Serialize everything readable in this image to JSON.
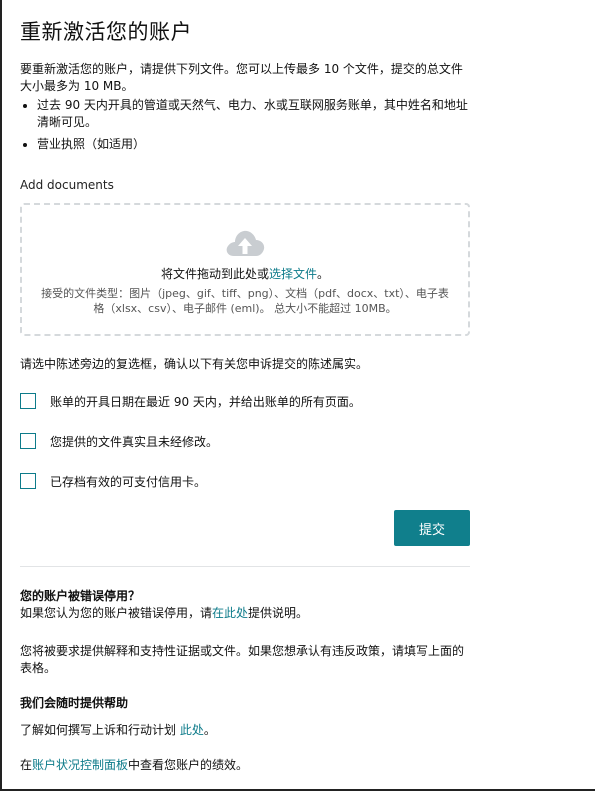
{
  "page": {
    "title": "重新激活您的账户",
    "intro": "要重新激活您的账户，请提供下列文件。您可以上传最多 10 个文件，提交的总文件大小最多为 10 MB。",
    "required_docs": [
      "过去 90 天内开具的管道或天然气、电力、水或互联网服务账单，其中姓名和地址清晰可见。",
      "营业执照（如适用）"
    ]
  },
  "upload": {
    "label": "Add documents",
    "drop_prefix": "将文件拖动到此处或",
    "choose_link": "选择文件",
    "drop_suffix": "。",
    "file_types": "接受的文件类型：图片（jpeg、gif、tiff、png）、文档（pdf、docx、txt）、电子表格（xlsx、csv）、电子邮件 (eml)。 总大小不能超过 10MB。",
    "icon": "cloud-upload-icon",
    "icon_color": "#c9cdd1"
  },
  "confirm": {
    "instruction": "请选中陈述旁边的复选框，确认以下有关您申诉提交的陈述属实。",
    "items": [
      {
        "label": "账单的开具日期在最近 90 天内，并给出账单的所有页面。",
        "checked": false
      },
      {
        "label": "您提供的文件真实且未经修改。",
        "checked": false
      },
      {
        "label": "已存档有效的可支付信用卡。",
        "checked": false
      }
    ]
  },
  "submit": {
    "label": "提交",
    "color": "#107f8c"
  },
  "help": {
    "wrong_title": "您的账户被错误停用？",
    "wrong_prefix": "如果您认为您的账户被错误停用，请",
    "wrong_link": "在此处",
    "wrong_suffix": "提供说明。",
    "evidence_text": "您将被要求提供解释和支持性证据或文件。如果您想承认有违反政策，请填写上面的表格。",
    "help_title": "我们会随时提供帮助",
    "appeal_prefix": "了解如何撰写上诉和行动计划 ",
    "appeal_link": "此处",
    "appeal_suffix": "。",
    "dashboard_prefix": "在",
    "dashboard_link": "账户状况控制面板",
    "dashboard_suffix": "中查看您账户的绩效。"
  },
  "colors": {
    "accent": "#0d7b8a",
    "text": "#111111"
  }
}
